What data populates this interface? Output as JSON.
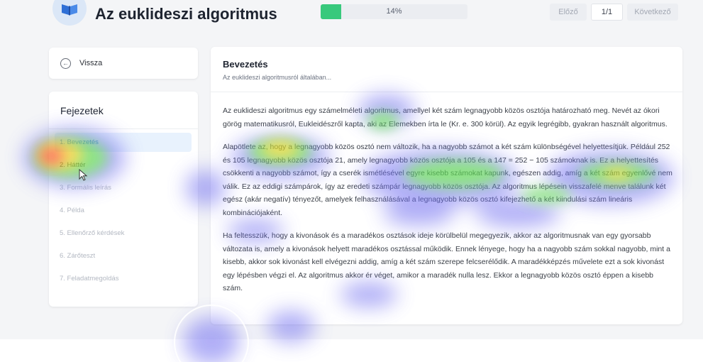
{
  "header": {
    "title": "Az euklideszi algoritmus",
    "logo_icon": "book-icon",
    "progress": {
      "percent": 14,
      "label": "14%",
      "color": "#38c97c"
    },
    "pager": {
      "prev_label": "Előző",
      "count_label": "1/1",
      "next_label": "Következő"
    }
  },
  "sidebar": {
    "back": {
      "icon": "arrow-left-circle-icon",
      "label": "Vissza"
    },
    "chapters": {
      "heading": "Fejezetek",
      "items": [
        {
          "label": "1. Bevezetés",
          "state": "active"
        },
        {
          "label": "2. Háttér",
          "state": "current"
        },
        {
          "label": "3. Formális leírás",
          "state": "disabled"
        },
        {
          "label": "4. Példa",
          "state": "disabled"
        },
        {
          "label": "5. Ellenőrző kérdések",
          "state": "disabled"
        },
        {
          "label": "6. Zárőteszt",
          "state": "disabled"
        },
        {
          "label": "7. Feladatmegoldás",
          "state": "disabled"
        }
      ]
    }
  },
  "main": {
    "title": "Bevezetés",
    "subtitle": "Az euklideszi algoritmusról általában...",
    "paragraphs": [
      "Az euklideszi algoritmus egy számelméleti algoritmus, amellyel két szám legnagyobb közös osztója határozható meg. Nevét az ókori görög matematikusról, Eukleidészről kapta, aki az Elemekben írta le (Kr. e. 300 körül). Az egyik legrégibb, gyakran használt algoritmus.",
      "Alapötlete az, hogy a legnagyobb közös osztó nem változik, ha a nagyobb számot a két szám különbségével helyettesítjük. Például 252 és 105 legnagyobb közös osztója 21, amely legnagyobb közös osztója a 105 és a 147 = 252 − 105 számoknak is. Ez a helyettesítés csökkenti a nagyobb számot, így a cserék ismétlésével egyre kisebb számokat kapunk, egészen addig, amíg a két szám egyenlővé nem válik. Ez az eddigi számpárok, így az eredeti számpár legnagyobb közös osztója. Az algoritmus lépésein visszafelé menve találunk két egész (akár negatív) tényezőt, amelyek felhasználásával a legnagyobb közös osztó kifejezhető a két kiindulási szám lineáris kombinációjaként.",
      "Ha feltesszük, hogy a kivonások és a maradékos osztások ideje körülbelül megegyezik, akkor az algoritmusnak van egy gyorsabb változata is, amely a kivonások helyett maradékos osztással működik. Ennek lényege, hogy ha a nagyobb szám sokkal nagyobb, mint a kisebb, akkor sok kivonást kell elvégezni addig, amíg a két szám szerepe felcserélődik. A maradékképzés művelete ezt a sok kivonást egy lépésben végzi el. Az algoritmus akkor ér véget, amikor a maradék nulla lesz. Ekkor a legnagyobb közös osztó éppen a kisebb szám."
    ]
  },
  "overlay": {
    "heatmap_colors": {
      "hot": "#ff3b2f",
      "warm": "#ffd21f",
      "mid": "#5ee04a",
      "cool": "#6e6cf0"
    },
    "cursor_icon": "mouse-pointer-icon"
  }
}
